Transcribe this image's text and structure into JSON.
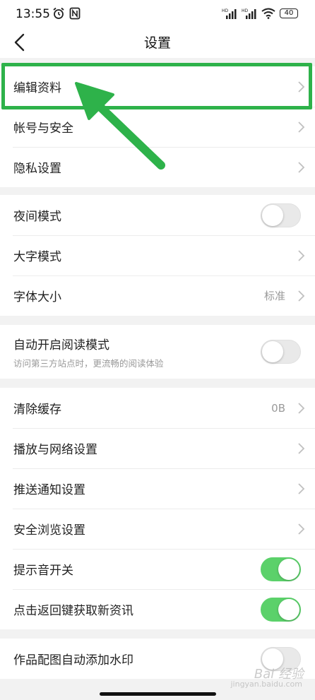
{
  "status_bar": {
    "time": "13:55",
    "battery": "40",
    "signal_label_1": "HD",
    "signal_label_2": "HD"
  },
  "header": {
    "title": "设置"
  },
  "groups": [
    {
      "items": [
        {
          "label": "编辑资料",
          "type": "link"
        },
        {
          "label": "帐号与安全",
          "type": "link"
        },
        {
          "label": "隐私设置",
          "type": "link"
        }
      ]
    },
    {
      "items": [
        {
          "label": "夜间模式",
          "type": "toggle",
          "on": false
        },
        {
          "label": "大字模式",
          "type": "link"
        },
        {
          "label": "字体大小",
          "type": "link",
          "value": "标准"
        }
      ]
    },
    {
      "items": [
        {
          "label": "自动开启阅读模式",
          "sub": "访问第三方站点时，更流畅的阅读体验",
          "type": "toggle",
          "on": false
        }
      ]
    },
    {
      "items": [
        {
          "label": "清除缓存",
          "type": "link",
          "value": "0B"
        },
        {
          "label": "播放与网络设置",
          "type": "link"
        },
        {
          "label": "推送通知设置",
          "type": "link"
        },
        {
          "label": "安全浏览设置",
          "type": "link"
        },
        {
          "label": "提示音开关",
          "type": "toggle",
          "on": true
        },
        {
          "label": "点击返回键获取新资讯",
          "type": "toggle",
          "on": true
        }
      ]
    },
    {
      "items": [
        {
          "label": "作品配图自动添加水印",
          "type": "toggle",
          "on": false
        }
      ]
    }
  ],
  "watermark": {
    "brand": "Bai 经验",
    "url": "jingyan.baidu.com"
  },
  "colors": {
    "highlight": "#2eb24a",
    "toggle_on": "#5bd16a",
    "toggle_off": "#e9e9e9"
  }
}
